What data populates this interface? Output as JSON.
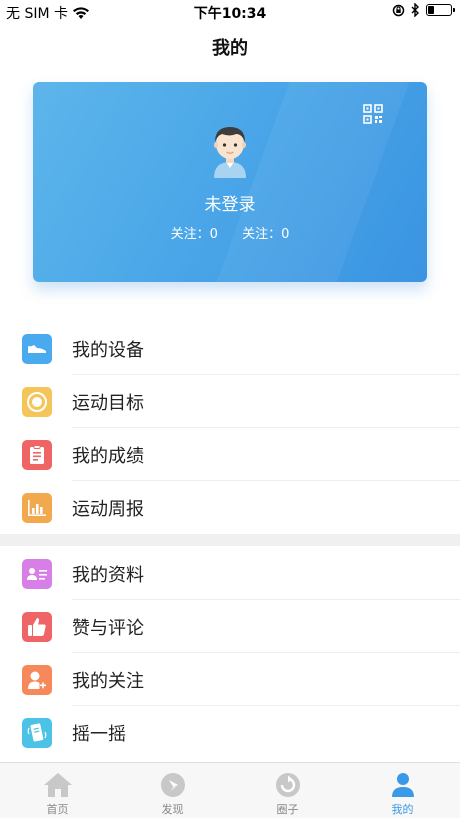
{
  "status_bar": {
    "carrier": "无 SIM 卡",
    "time": "下午10:34",
    "battery_level": 0.3
  },
  "nav": {
    "title": "我的"
  },
  "profile": {
    "username": "未登录",
    "follow_label_1": "关注：0",
    "follow_label_2": "关注：0"
  },
  "menu_group_1": [
    {
      "label": "我的设备",
      "icon": "shoe-icon",
      "color": "#4aaaf0"
    },
    {
      "label": "运动目标",
      "icon": "target-icon",
      "color": "#f5c55a"
    },
    {
      "label": "我的成绩",
      "icon": "clipboard-icon",
      "color": "#ef6464"
    },
    {
      "label": "运动周报",
      "icon": "bar-chart-icon",
      "color": "#f2a94e"
    }
  ],
  "menu_group_2": [
    {
      "label": "我的资料",
      "icon": "profile-card-icon",
      "color": "#d77fe6"
    },
    {
      "label": "赞与评论",
      "icon": "thumbs-up-icon",
      "color": "#ef6464"
    },
    {
      "label": "我的关注",
      "icon": "add-user-icon",
      "color": "#f5895a"
    },
    {
      "label": "摇一摇",
      "icon": "shake-phone-icon",
      "color": "#4cc3e6"
    }
  ],
  "tabs": [
    {
      "label": "首页",
      "icon": "home-icon",
      "active": false
    },
    {
      "label": "发现",
      "icon": "compass-icon",
      "active": false
    },
    {
      "label": "圈子",
      "icon": "circle-refresh-icon",
      "active": false
    },
    {
      "label": "我的",
      "icon": "person-icon",
      "active": true
    }
  ],
  "colors": {
    "accent": "#3a9ae8",
    "card_start": "#5db5ea",
    "card_end": "#3a94e2"
  }
}
